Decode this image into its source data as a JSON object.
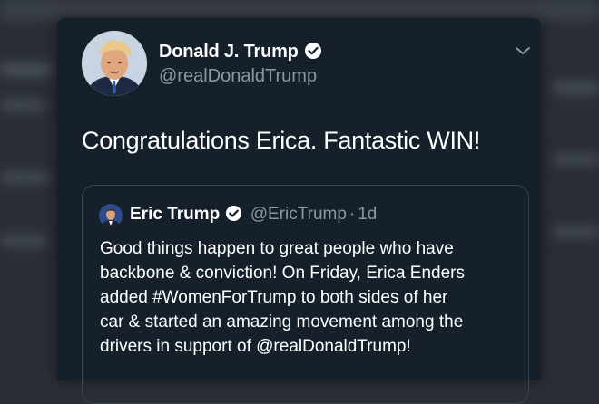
{
  "tweet": {
    "author_name": "Donald J. Trump",
    "author_handle": "@realDonaldTrump",
    "text": "Congratulations Erica. Fantastic WIN!"
  },
  "quoted_tweet": {
    "author_name": "Eric Trump",
    "author_handle": "@EricTrump",
    "separator": "·",
    "time": "1d",
    "text_lines": [
      "Good things happen to great people who have",
      "backbone & conviction! On Friday, Erica Enders",
      "added #WomenForTrump to both sides of her",
      "car & started an amazing movement among the",
      "drivers in support of @realDonaldTrump!"
    ]
  },
  "icons": {
    "verified": "verified-badge-icon",
    "more": "chevron-down-icon"
  },
  "colors": {
    "background": "#15202b",
    "text": "#ffffff",
    "secondary_text": "#8899a6",
    "border": "#38444d"
  }
}
